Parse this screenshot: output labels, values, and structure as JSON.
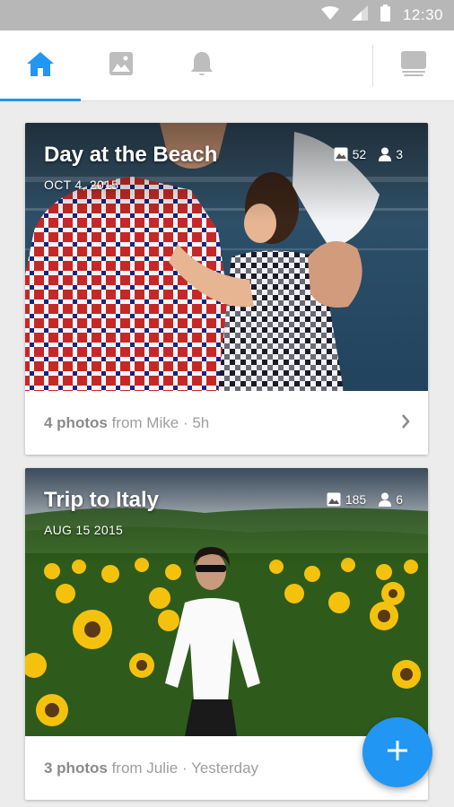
{
  "status_bar": {
    "time": "12:30",
    "icons": [
      "wifi-icon",
      "signal-icon",
      "battery-icon"
    ]
  },
  "tabs": [
    {
      "name": "home",
      "icon": "home-icon",
      "active": true
    },
    {
      "name": "photos",
      "icon": "photo-icon",
      "active": false
    },
    {
      "name": "notifications",
      "icon": "bell-icon",
      "active": false
    },
    {
      "name": "library",
      "icon": "stack-icon",
      "active": false
    }
  ],
  "colors": {
    "accent": "#2196f3",
    "status_bar": "#b7b7b7",
    "background": "#ececec",
    "inactive_icon": "#bdbdbd"
  },
  "cards": [
    {
      "title": "Day at the Beach",
      "date": "OCT 4, 2015",
      "photo_count": "52",
      "people_count": "3",
      "footer_count": "4 photos",
      "footer_from": "from Mike",
      "footer_time": "· 5h"
    },
    {
      "title": "Trip to Italy",
      "date": "AUG 15 2015",
      "photo_count": "185",
      "people_count": "6",
      "footer_count": "3 photos",
      "footer_from": "from Julie",
      "footer_time": "· Yesterday"
    }
  ],
  "fab": {
    "icon": "plus-icon"
  }
}
